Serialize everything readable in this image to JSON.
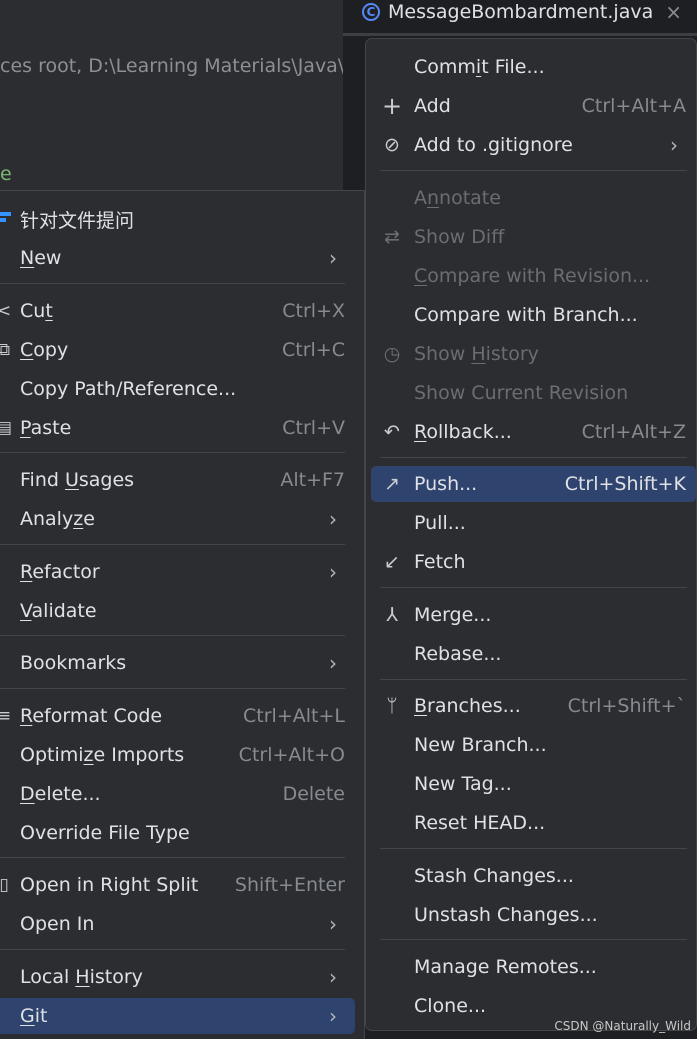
{
  "editor": {
    "tab_title": "MessageBombardment.java",
    "tab_icon": "C",
    "tab_close": "×",
    "path_text": "ces root,  D:\\Learning Materials\\Java\\c",
    "green_char": "e"
  },
  "context_menu": {
    "items": [
      {
        "label": "针对文件提问",
        "icon": "ai-chat-icon"
      },
      {
        "label_u": "N",
        "label_rest": "ew",
        "arrow": "›"
      },
      {
        "label_pre": "Cu",
        "label_u": "t",
        "shortcut": "Ctrl+X",
        "icon": "cut-icon"
      },
      {
        "label_u": "C",
        "label_rest": "opy",
        "shortcut": "Ctrl+C",
        "icon": "copy-icon"
      },
      {
        "label": "Copy Path/Reference..."
      },
      {
        "label_u": "P",
        "label_rest": "aste",
        "shortcut": "Ctrl+V",
        "icon": "paste-icon"
      },
      {
        "label_pre": "Find ",
        "label_u": "U",
        "label_rest": "sages",
        "shortcut": "Alt+F7"
      },
      {
        "label_pre": "Analy",
        "label_u": "z",
        "label_rest": "e",
        "arrow": "›"
      },
      {
        "label_u": "R",
        "label_rest": "efactor",
        "arrow": "›"
      },
      {
        "label_u": "V",
        "label_rest": "alidate"
      },
      {
        "label": "Bookmarks",
        "arrow": "›"
      },
      {
        "label_u": "R",
        "label_rest": "eformat Code",
        "shortcut": "Ctrl+Alt+L",
        "icon": "reformat-icon"
      },
      {
        "label_pre": "Optimi",
        "label_u": "z",
        "label_rest": "e Imports",
        "shortcut": "Ctrl+Alt+O"
      },
      {
        "label_u": "D",
        "label_rest": "elete...",
        "shortcut": "Delete"
      },
      {
        "label": "Override File Type"
      },
      {
        "label": "Open in Right Split",
        "shortcut": "Shift+Enter",
        "icon": "split-icon"
      },
      {
        "label": "Open In",
        "arrow": "›"
      },
      {
        "label_pre": "Local ",
        "label_u": "H",
        "label_rest": "istory",
        "arrow": "›"
      },
      {
        "label_u": "G",
        "label_rest": "it",
        "arrow": "›"
      }
    ]
  },
  "git_menu": {
    "items": [
      {
        "label_pre": "Comm",
        "label_u": "i",
        "label_rest": "t File..."
      },
      {
        "label": "Add",
        "shortcut": "Ctrl+Alt+A",
        "icon": "plus-icon"
      },
      {
        "label": "Add to .gitignore",
        "arrow": "›",
        "icon": "ignore-icon"
      },
      {
        "label_pre": "A",
        "label_u": "n",
        "label_rest": "notate",
        "disabled": true
      },
      {
        "label": "Show Diff",
        "disabled": true,
        "icon": "diff-icon"
      },
      {
        "label_u": "C",
        "label_rest": "ompare with Revision...",
        "disabled": true
      },
      {
        "label": "Compare with Branch..."
      },
      {
        "label_pre": "Show ",
        "label_u": "H",
        "label_rest": "istory",
        "disabled": true,
        "icon": "history-icon"
      },
      {
        "label": "Show Current Revision",
        "disabled": true
      },
      {
        "label_u": "R",
        "label_rest": "ollback...",
        "shortcut": "Ctrl+Alt+Z",
        "icon": "rollback-icon"
      },
      {
        "label": "Push...",
        "shortcut": "Ctrl+Shift+K",
        "icon": "push-arrow-icon"
      },
      {
        "label": "Pull..."
      },
      {
        "label": "Fetch",
        "icon": "fetch-icon"
      },
      {
        "label": "Merge...",
        "icon": "merge-icon"
      },
      {
        "label": "Rebase..."
      },
      {
        "label_u": "B",
        "label_rest": "ranches...",
        "shortcut": "Ctrl+Shift+`",
        "icon": "branch-icon"
      },
      {
        "label": "New Branch..."
      },
      {
        "label": "New Tag..."
      },
      {
        "label": "Reset HEAD..."
      },
      {
        "label": "Stash Changes..."
      },
      {
        "label": "Unstash Changes..."
      },
      {
        "label": "Manage Remotes..."
      },
      {
        "label": "Clone..."
      }
    ]
  },
  "glyphs": {
    "cut": "<",
    "copy": "⧉",
    "paste": "▤",
    "reformat": "≡",
    "split": "▯",
    "plus": "+",
    "ignore": "⊘",
    "diff": "⇄",
    "history": "◷",
    "rollback": "↶",
    "push": "↗",
    "fetch": "↙",
    "merge": "⅄",
    "branch": "ᛘ"
  },
  "watermark": "CSDN @Naturally_Wild",
  "colors": {
    "selection": "#2e436e",
    "menu_bg": "#2b2d30",
    "accent": "#548af7"
  }
}
